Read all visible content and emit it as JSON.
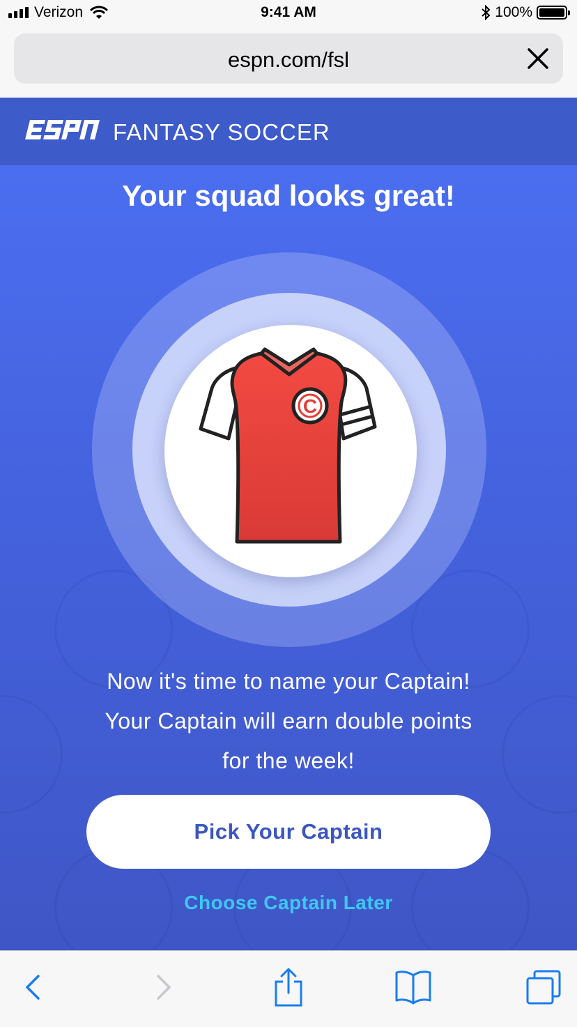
{
  "status_bar": {
    "carrier": "Verizon",
    "time": "9:41 AM",
    "battery": "100%",
    "icons": [
      "signal-icon",
      "wifi-icon",
      "bluetooth-icon",
      "battery-icon"
    ]
  },
  "browser": {
    "url": "espn.com/fsl",
    "close_icon": "close-icon"
  },
  "header": {
    "logo": "ESPN",
    "title": "FANTASY SOCCER"
  },
  "main": {
    "headline": "Your squad looks great!",
    "jersey_badge": "C",
    "message_lines": [
      "Now it's time to name your Captain!",
      "Your Captain will earn double points",
      "for the week!"
    ],
    "primary_button": "Pick Your Captain",
    "secondary_link": "Choose Captain Later"
  },
  "toolbar": {
    "icons": [
      "back-icon",
      "forward-icon",
      "share-icon",
      "bookmarks-icon",
      "tabs-icon"
    ]
  },
  "colors": {
    "header_bg": "#3d5bc9",
    "main_bg": "#4563df",
    "button_text": "#3b56c0",
    "link": "#3ec8f2",
    "jersey_red": "#e8433e",
    "toolbar_icon": "#1a7cf2"
  }
}
